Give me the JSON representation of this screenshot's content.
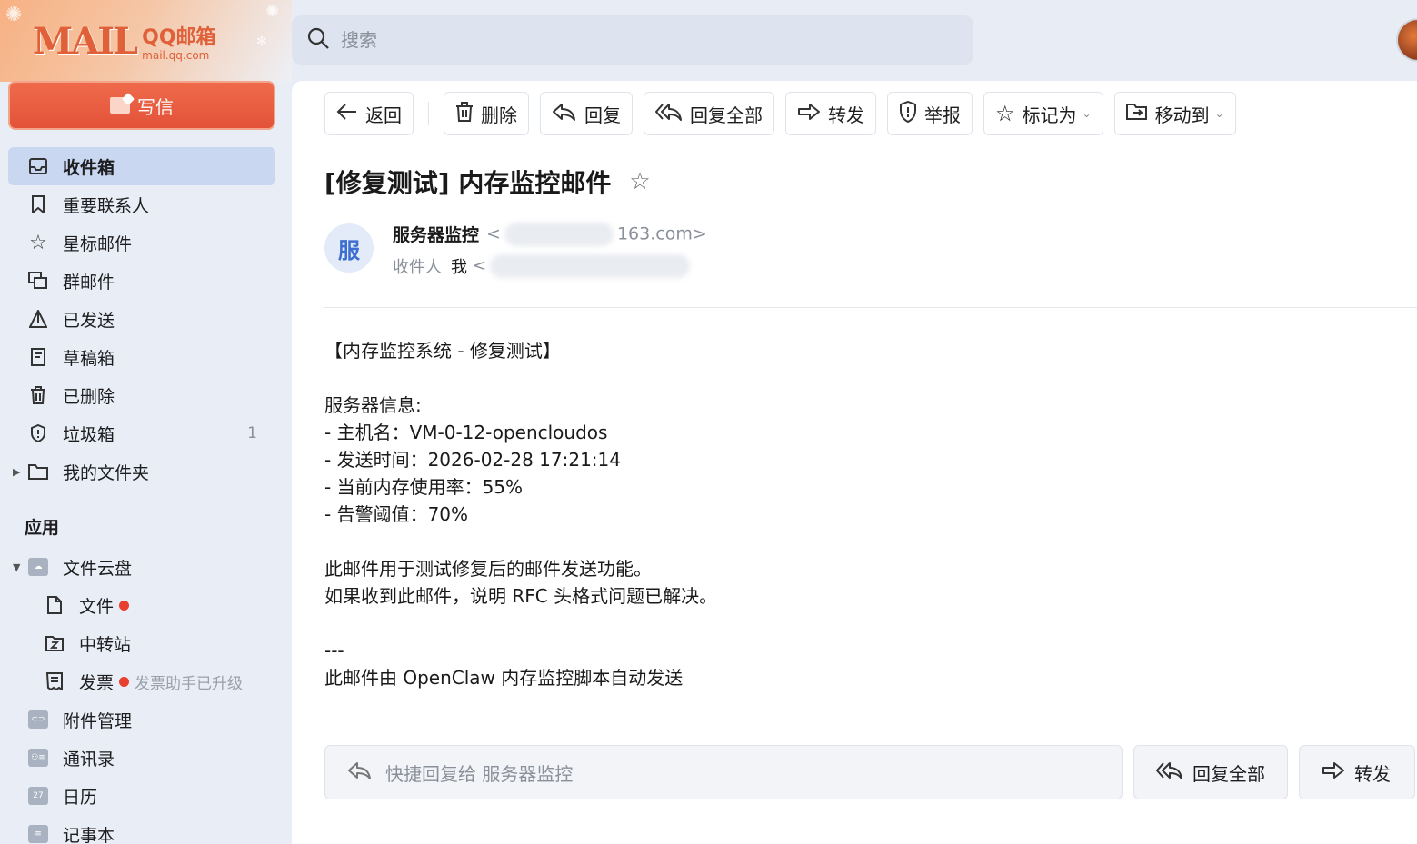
{
  "brand": {
    "logo_text": "MAIL",
    "product": "QQ邮箱",
    "domain": "mail.qq.com"
  },
  "compose": {
    "label": "写信"
  },
  "search": {
    "placeholder": "搜索"
  },
  "nav": [
    {
      "label": "收件箱",
      "icon": "inbox-icon",
      "active": true
    },
    {
      "label": "重要联系人",
      "icon": "bookmark-icon"
    },
    {
      "label": "星标邮件",
      "icon": "star-icon"
    },
    {
      "label": "群邮件",
      "icon": "group-mail-icon"
    },
    {
      "label": "已发送",
      "icon": "sent-icon"
    },
    {
      "label": "草稿箱",
      "icon": "draft-icon"
    },
    {
      "label": "已删除",
      "icon": "trash-icon"
    },
    {
      "label": "垃圾箱",
      "icon": "spam-shield-icon",
      "count": "1"
    },
    {
      "label": "我的文件夹",
      "icon": "folder-icon"
    }
  ],
  "apps": {
    "title": "应用",
    "items": [
      {
        "label": "文件云盘",
        "icon": "cloud-drive-icon"
      },
      {
        "label": "文件",
        "icon": "file-icon",
        "dot": true
      },
      {
        "label": "中转站",
        "icon": "transfer-icon"
      },
      {
        "label": "发票",
        "icon": "invoice-icon",
        "dot": true,
        "hint": "发票助手已升级"
      },
      {
        "label": "附件管理",
        "icon": "attachment-icon"
      },
      {
        "label": "通讯录",
        "icon": "contacts-icon"
      },
      {
        "label": "日历",
        "icon": "calendar-icon",
        "badge": "27"
      },
      {
        "label": "记事本",
        "icon": "notebook-icon"
      }
    ]
  },
  "toolbar": {
    "back": "返回",
    "delete": "删除",
    "reply": "回复",
    "reply_all": "回复全部",
    "forward": "转发",
    "report": "举报",
    "mark_as": "标记为",
    "move_to": "移动到"
  },
  "email": {
    "subject": "[修复测试] 内存监控邮件",
    "sender_initial": "服",
    "sender_name": "服务器监控",
    "sender_addr_suffix": "163.com>",
    "recipient_label": "收件人",
    "recipient_me": "我",
    "body": "【内存监控系统 - 修复测试】\n\n服务器信息:\n- 主机名：VM-0-12-opencloudos\n- 发送时间：2026-02-28 17:21:14\n- 当前内存使用率：55%\n- 告警阈值：70%\n\n此邮件用于测试修复后的邮件发送功能。\n如果收到此邮件，说明 RFC 头格式问题已解决。\n\n---\n此邮件由 OpenClaw 内存监控脚本自动发送"
  },
  "quick_reply": {
    "placeholder": "快捷回复给 服务器监控",
    "reply_all": "回复全部",
    "forward": "转发"
  },
  "colors": {
    "accent": "#e3533a",
    "active_nav": "#c9d7f0",
    "sidebar_bg": "#e9eef6"
  }
}
